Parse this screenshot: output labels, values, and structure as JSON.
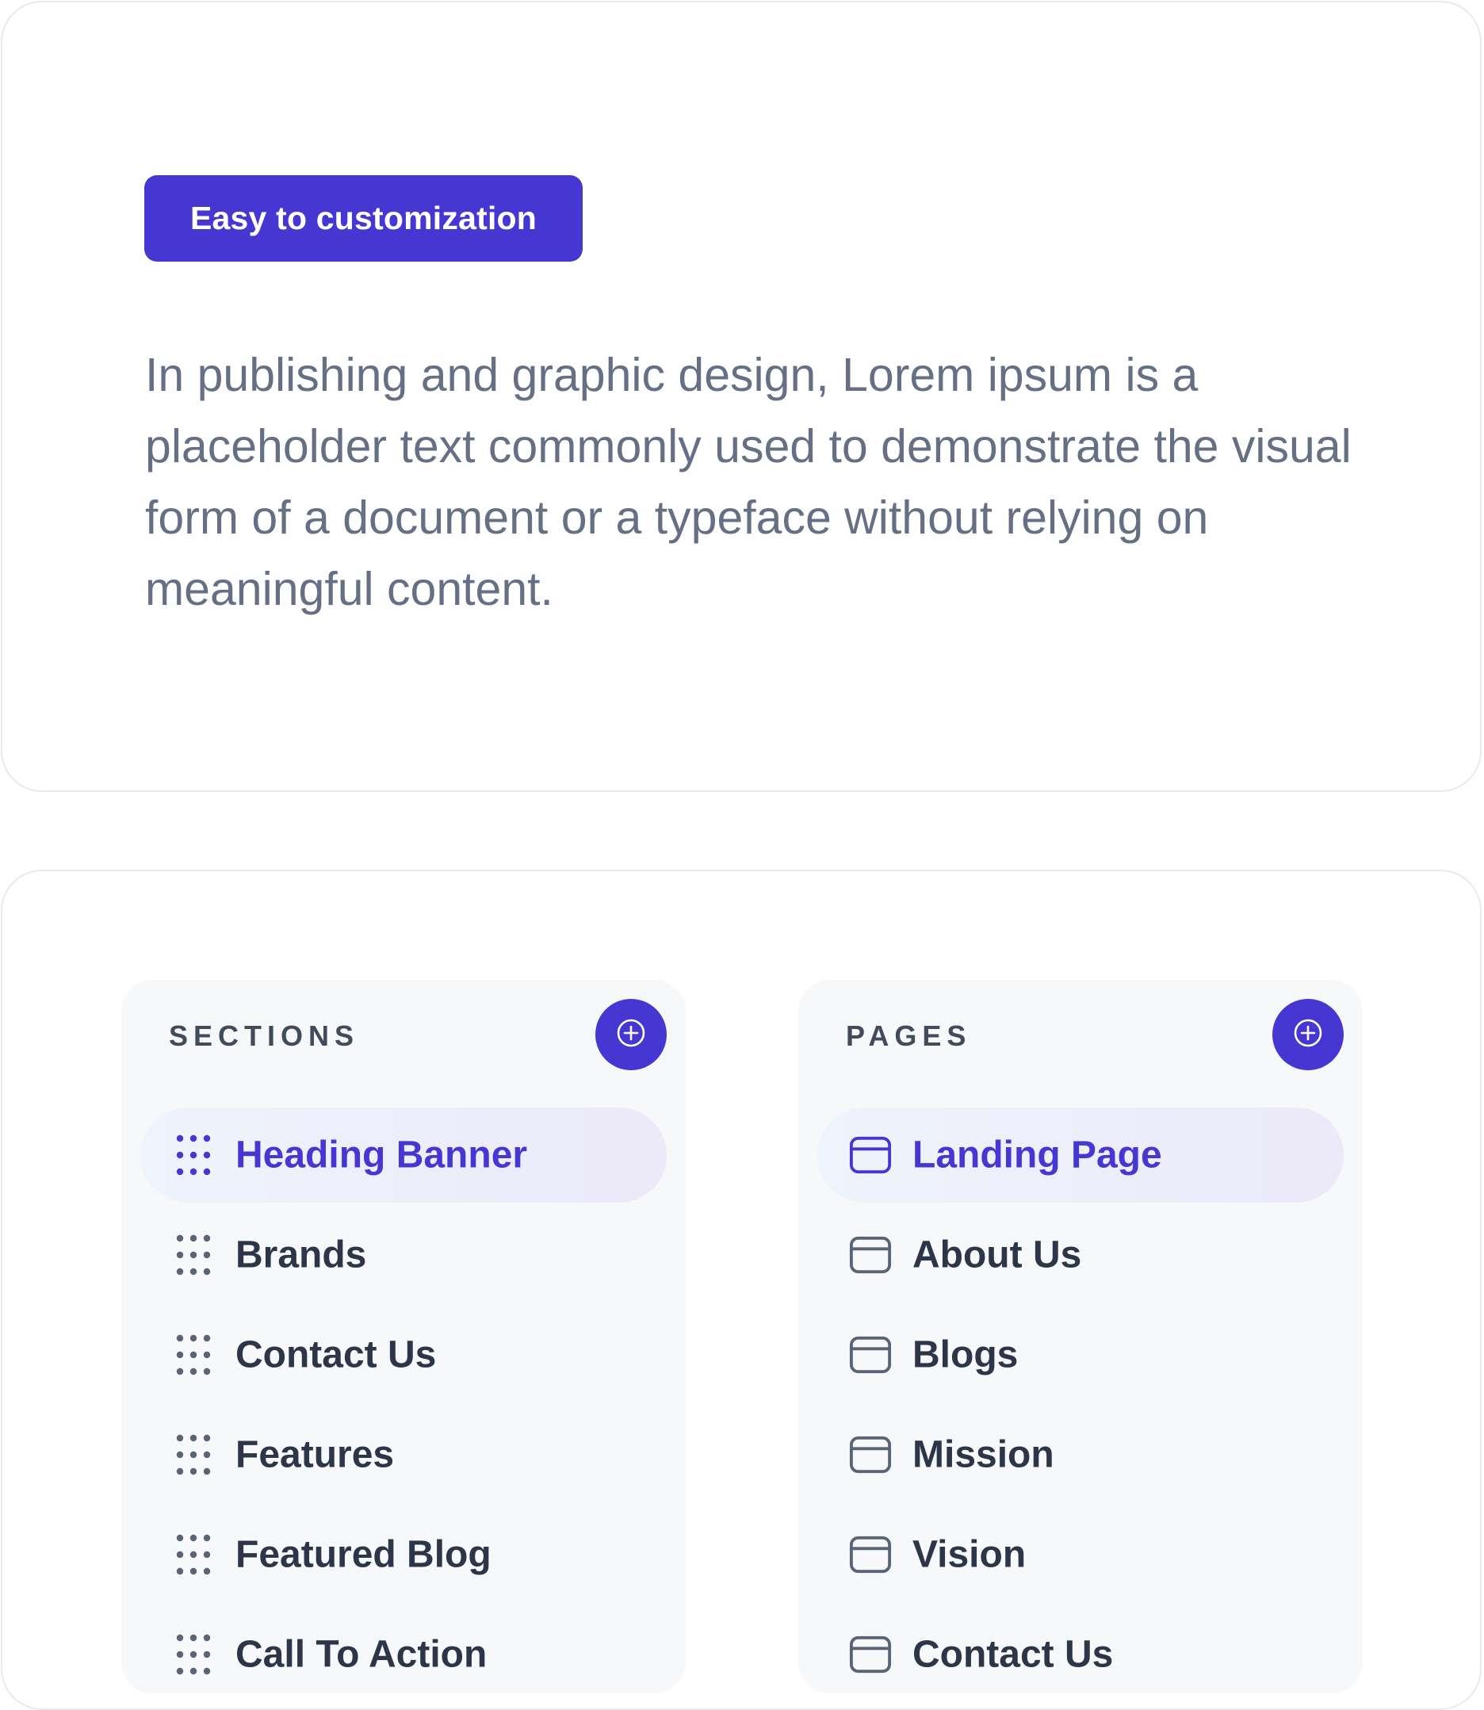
{
  "badge": {
    "label": "Easy to customization"
  },
  "description": "In publishing and graphic design, Lorem ipsum is a placeholder text commonly used to demonstrate the visual form of a document or a typeface without relying on meaningful content.",
  "colors": {
    "accent": "#4637d3",
    "text_muted": "#667085",
    "text_dark": "#2d3648",
    "panel_bg": "#f7f8fa"
  },
  "sections_panel": {
    "title": "SECTIONS",
    "add_icon": "plus-circle-icon",
    "item_icon": "drag-handle-icon",
    "items": [
      {
        "label": "Heading Banner",
        "active": true
      },
      {
        "label": "Brands",
        "active": false
      },
      {
        "label": "Contact Us",
        "active": false
      },
      {
        "label": "Features",
        "active": false
      },
      {
        "label": "Featured Blog",
        "active": false
      },
      {
        "label": "Call To Action",
        "active": false
      }
    ]
  },
  "pages_panel": {
    "title": "PAGES",
    "add_icon": "plus-circle-icon",
    "item_icon": "browser-window-icon",
    "items": [
      {
        "label": "Landing Page",
        "active": true
      },
      {
        "label": "About Us",
        "active": false
      },
      {
        "label": "Blogs",
        "active": false
      },
      {
        "label": "Mission",
        "active": false
      },
      {
        "label": "Vision",
        "active": false
      },
      {
        "label": "Contact Us",
        "active": false
      }
    ]
  }
}
